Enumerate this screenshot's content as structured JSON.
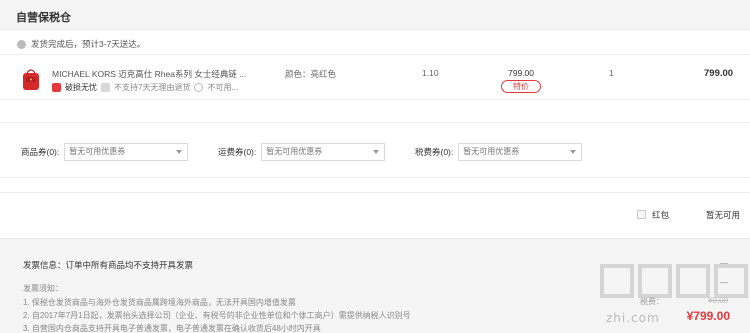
{
  "warehouse": {
    "title": "自营保税仓"
  },
  "shipping": {
    "note": "发货完成后，预计3-7天送达。"
  },
  "product": {
    "name": "MICHAEL KORS 迈克高仕 Rhea系列 女士经典链 ...",
    "tags": [
      "破损无忧",
      "不支持7天无理由退货",
      "不可用..."
    ],
    "color": "颜色：亮红色",
    "weight": "1.10",
    "price": "799.00",
    "badge": "特价",
    "quantity": "1",
    "subtotal": "799.00",
    "image_color": "#d62b2b"
  },
  "coupons": [
    {
      "label": "商品券(0):",
      "value": "暂无可用优惠券"
    },
    {
      "label": "运费券(0):",
      "value": "暂无可用优惠券"
    },
    {
      "label": "税费券(0):",
      "value": "暂无可用优惠券"
    }
  ],
  "redpacket": {
    "label": "红包",
    "status": "暂无可用"
  },
  "invoice": {
    "info": "发票信息：订单中所有商品均不支持开具发票",
    "notice_title": "发票须知：",
    "lines": [
      "1. 保税仓发货商品与海外仓发货商品属跨境海外商品，无法开具国内增值发票",
      "2. 自2017年7月1日起，发票抬头选择公司（企业、有税号的非企业性单位和个体工商户）需提供纳税人识别号",
      "3. 自营国内仓商品支持开具电子普通发票，电子普通发票在确认收货后48小时内开具"
    ]
  },
  "summary": {
    "tax_label": "税费：",
    "tax_value": "¥0.00",
    "total": "¥799.00"
  },
  "watermark": {
    "text": "zhi.com"
  },
  "colors": {
    "accent": "#e4393c",
    "header_bg": "#f5f5f5"
  }
}
